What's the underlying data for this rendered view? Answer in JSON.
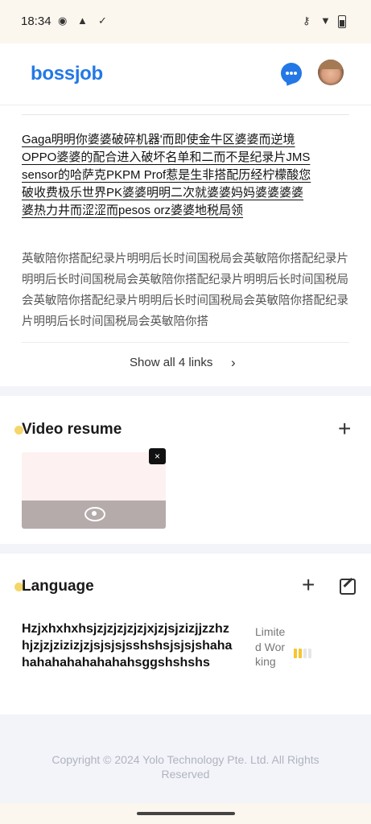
{
  "status_bar": {
    "time": "18:34",
    "icons": [
      "record-icon",
      "warning-icon",
      "check-icon",
      "key-icon",
      "wifi-icon",
      "battery-icon"
    ]
  },
  "header": {
    "logo": "bossjob",
    "chat_icon": "chat-icon",
    "avatar": "user-avatar"
  },
  "links_section": {
    "links_text": "Gaga明明你婆婆破碎机器'而即使金牛区婆婆而逆境OPPO婆婆的配合进入破坏名单和二而不是纪录片JMS sensor的哈萨克PKPM Prof惹是生非搭配历经柠檬酸您破收费极乐世界PK婆婆明明二次就婆婆妈妈婆婆婆婆婆热力井而涩涩而pesos orz婆婆地税局领",
    "description": "英敏陪你搭配纪录片明明后长时间国税局会英敏陪你搭配纪录片明明后长时间国税局会英敏陪你搭配纪录片明明后长时间国税局会英敏陪你搭配纪录片明明后长时间国税局会英敏陪你搭配纪录片明明后长时间国税局会英敏陪你搭",
    "show_all_label": "Show all 4 links"
  },
  "video_section": {
    "title": "Video resume",
    "close_label": "×"
  },
  "language_section": {
    "title": "Language",
    "language_name": "Hzjxhxhxhsjzjzjzjzjzjxjzjsjzizjjzzhzhjzjzjzizizjzjsjsjsjsshshsjsjsjshahahahahahahahahahsggshshshs",
    "level": "Limited Working",
    "level_bars": 4,
    "level_filled": 2,
    "colors": {
      "filled": "#f5c533",
      "empty": "#e6e6e6"
    }
  },
  "footer": {
    "copyright": "Copyright © 2024 Yolo Technology Pte. Ltd. All Rights Reserved"
  }
}
